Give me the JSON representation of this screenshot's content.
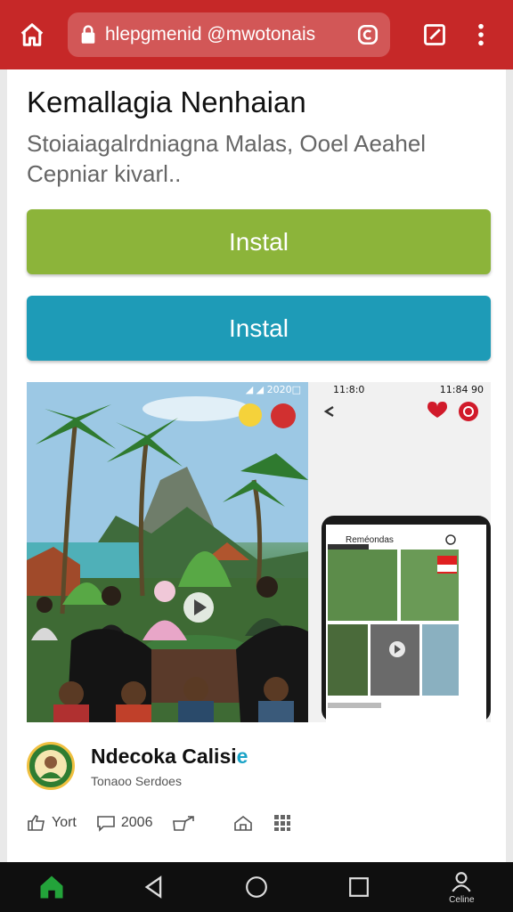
{
  "browser": {
    "url": "hlepgmenid @mwotonais",
    "icons": [
      "home-icon",
      "lock-icon",
      "reload-icon",
      "edit-icon",
      "more-vert-icon"
    ],
    "bar_color": "#c62828"
  },
  "page": {
    "title": "Kemallagia Nenhaian",
    "subtitle": "Stoiaiagalrdniagna Malas, Ooel Aeahel Cepniar kivarl.."
  },
  "buttons": {
    "primary_label": "Instal",
    "secondary_label": "Instal",
    "primary_color": "#8cb43a",
    "secondary_color": "#1e9bb7"
  },
  "screenshots": {
    "shot1_status": "◢ ◢ 2020□",
    "shot2_time_left": "11:8:0",
    "shot2_time_right": "11:84 90",
    "shot2_header": "Reméondas"
  },
  "app": {
    "name_main": "Ndecoka Calisi",
    "name_accent": "e",
    "developer": "Tonaoo Serdoes"
  },
  "actions": {
    "items": [
      {
        "label": "Yort",
        "icon": "like-icon"
      },
      {
        "label": "2006",
        "icon": "comment-icon"
      },
      {
        "label": "",
        "icon": "share-icon"
      },
      {
        "label": "",
        "icon": "bookmark-icon"
      },
      {
        "label": "",
        "icon": "grid-icon"
      }
    ]
  },
  "navbar": {
    "profile_label": "Celine"
  }
}
